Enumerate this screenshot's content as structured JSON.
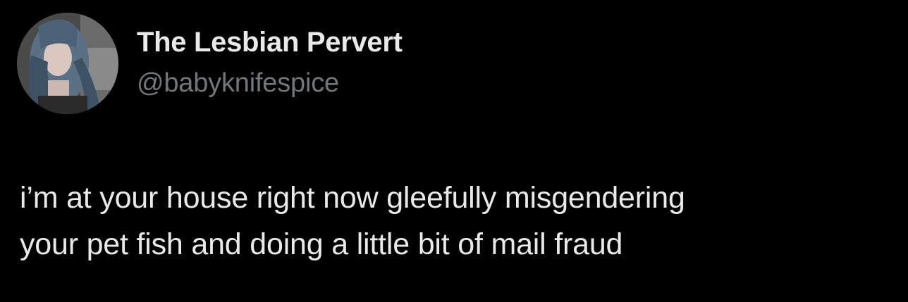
{
  "tweet": {
    "author": {
      "display_name": "The Lesbian Pervert",
      "handle": "@babyknifespice",
      "avatar_icon": "profile-photo"
    },
    "text_lines": [
      "i’m at your house right now gleefully misgendering",
      "your pet fish and doing a little bit of mail fraud"
    ]
  },
  "colors": {
    "background": "#000000",
    "primary_text": "#e7e9ea",
    "secondary_text": "#71767b"
  }
}
